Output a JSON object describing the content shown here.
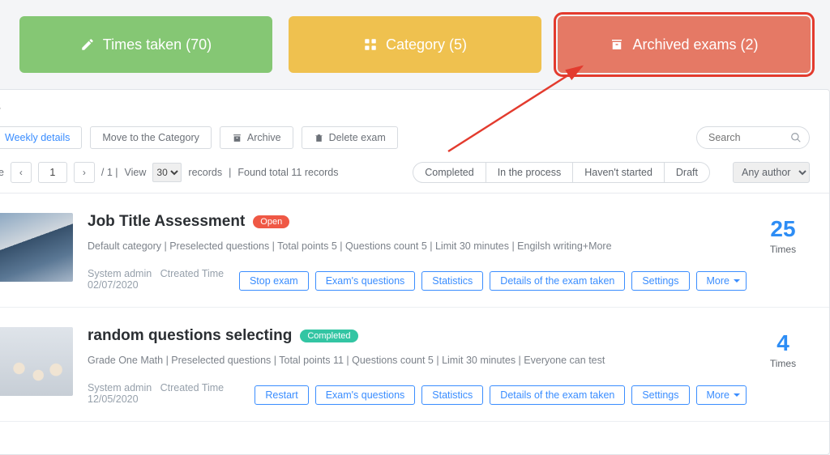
{
  "top_cards": {
    "times_taken": {
      "label": "Times taken (70)"
    },
    "category": {
      "label": "Category (5)"
    },
    "archived": {
      "label": "Archived exams (2)"
    }
  },
  "panel_title": "s",
  "toolbar": {
    "weekly_details": "Weekly details",
    "move_category": "Move to the Category",
    "archive": "Archive",
    "delete_exam": "Delete exam",
    "search_placeholder": "Search"
  },
  "pager": {
    "prefix": "ge",
    "page": "1",
    "total_pages": "1",
    "view_label": "View",
    "per_page": "30",
    "records_label": "records",
    "found_text": "Found total 11 records"
  },
  "status_filters": {
    "completed": "Completed",
    "in_process": "In the process",
    "havent_started": "Haven't started",
    "draft": "Draft"
  },
  "author_select": "Any author",
  "exams": [
    {
      "title": "Job Title Assessment",
      "badge_text": "Open",
      "badge_kind": "open",
      "meta": "Default category | Preselected questions | Total points 5 | Questions count 5 | Limit 30 minutes | Engilsh writing+More",
      "by": "System admin",
      "created_label": "Ctreated Time 02/07/2020",
      "times": "25",
      "times_label": "Times",
      "primary_action": "Stop exam"
    },
    {
      "title": "random questions selecting",
      "badge_text": "Completed",
      "badge_kind": "completed",
      "meta": "Grade One Math | Preselected questions | Total points 11 | Questions count 5 | Limit 30 minutes | Everyone can test",
      "by": "System admin",
      "created_label": "Ctreated Time 12/05/2020",
      "times": "4",
      "times_label": "Times",
      "primary_action": "Restart"
    }
  ],
  "row_actions": {
    "exam_questions": "Exam's questions",
    "statistics": "Statistics",
    "details": "Details of the exam taken",
    "settings": "Settings",
    "more": "More"
  }
}
